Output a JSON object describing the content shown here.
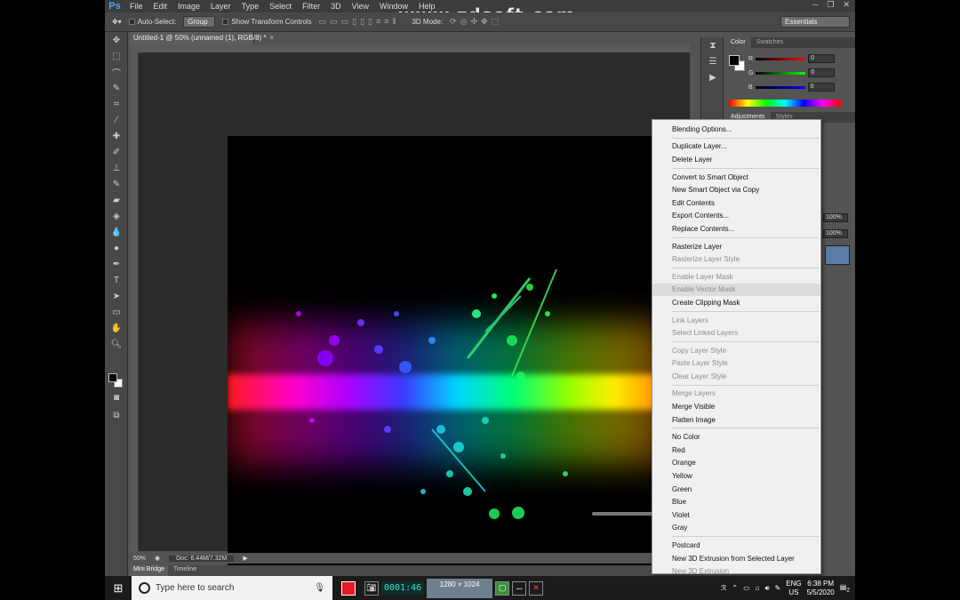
{
  "watermark": "www.zdsoft.com",
  "app": {
    "logo": "Ps"
  },
  "menu": [
    "File",
    "Edit",
    "Image",
    "Layer",
    "Type",
    "Select",
    "Filter",
    "3D",
    "View",
    "Window",
    "Help"
  ],
  "options": {
    "auto_select_label": "Auto-Select:",
    "auto_select_value": "Group",
    "transform_label": "Show Transform Controls",
    "mode_3d_label": "3D Mode:",
    "workspace": "Essentials"
  },
  "document": {
    "tab_title": "Untitled-1 @ 50% (unnamed (1), RGB/8) *",
    "zoom": "50%",
    "doc_info": "Doc: 6.44M/7.32M"
  },
  "bottom_tabs": [
    "Mini Bridge",
    "Timeline"
  ],
  "panels": {
    "color_tabs": [
      "Color",
      "Swatches"
    ],
    "rgb": [
      {
        "label": "R",
        "value": "0"
      },
      {
        "label": "G",
        "value": "0"
      },
      {
        "label": "B",
        "value": "0"
      }
    ],
    "adjust_tabs": [
      "Adjustments",
      "Styles"
    ],
    "opacity": "100%",
    "fill": "100%"
  },
  "context_menu": [
    {
      "label": "Blending Options...",
      "enabled": true
    },
    {
      "sep": true
    },
    {
      "label": "Duplicate Layer...",
      "enabled": true
    },
    {
      "label": "Delete Layer",
      "enabled": true
    },
    {
      "sep": true
    },
    {
      "label": "Convert to Smart Object",
      "enabled": true
    },
    {
      "label": "New Smart Object via Copy",
      "enabled": true
    },
    {
      "label": "Edit Contents",
      "enabled": true
    },
    {
      "label": "Export Contents...",
      "enabled": true
    },
    {
      "label": "Replace Contents...",
      "enabled": true
    },
    {
      "sep": true
    },
    {
      "label": "Rasterize Layer",
      "enabled": true
    },
    {
      "label": "Rasterize Layer Style",
      "enabled": false
    },
    {
      "sep": true
    },
    {
      "label": "Enable Layer Mask",
      "enabled": false
    },
    {
      "label": "Enable Vector Mask",
      "enabled": false,
      "hover": true
    },
    {
      "label": "Create Clipping Mask",
      "enabled": true
    },
    {
      "sep": true
    },
    {
      "label": "Link Layers",
      "enabled": false
    },
    {
      "label": "Select Linked Layers",
      "enabled": false
    },
    {
      "sep": true
    },
    {
      "label": "Copy Layer Style",
      "enabled": false
    },
    {
      "label": "Paste Layer Style",
      "enabled": false
    },
    {
      "label": "Clear Layer Style",
      "enabled": false
    },
    {
      "sep": true
    },
    {
      "label": "Merge Layers",
      "enabled": false
    },
    {
      "label": "Merge Visible",
      "enabled": true
    },
    {
      "label": "Flatten Image",
      "enabled": true
    },
    {
      "sep": true
    },
    {
      "label": "No Color",
      "enabled": true
    },
    {
      "label": "Red",
      "enabled": true
    },
    {
      "label": "Orange",
      "enabled": true
    },
    {
      "label": "Yellow",
      "enabled": true
    },
    {
      "label": "Green",
      "enabled": true
    },
    {
      "label": "Blue",
      "enabled": true
    },
    {
      "label": "Violet",
      "enabled": true
    },
    {
      "label": "Gray",
      "enabled": true
    },
    {
      "sep": true
    },
    {
      "label": "Postcard",
      "enabled": true
    },
    {
      "label": "New 3D Extrusion from Selected Layer",
      "enabled": true
    },
    {
      "label": "New 3D Extrusion",
      "enabled": false
    }
  ],
  "taskbar": {
    "search_placeholder": "Type here to search",
    "recorder_counter": "0001:46",
    "recorder_resolution": "1280 × 1024",
    "lang_top": "ENG",
    "lang_bottom": "US",
    "time": "6:38 PM",
    "date": "5/5/2020",
    "notifications": "2"
  },
  "colors": {
    "accent": "#4aa7ff",
    "band_start": "#ff1a1a",
    "band_mid": "#00d4ff",
    "band_end": "#ff7a00"
  }
}
